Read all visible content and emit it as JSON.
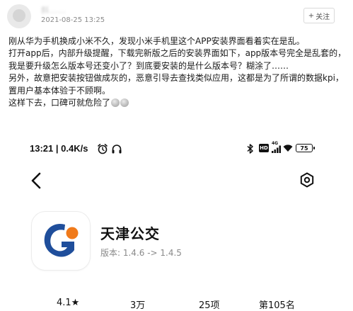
{
  "post": {
    "username": "斜……",
    "timestamp": "2021-08-25 13:25",
    "follow_label": "关注",
    "paragraphs": [
      "刚从华为手机换成小米不久，发现小米手机里这个APP安装界面看着实在是乱。",
      "打开app后，内部升级提醒，下载完新版之后的安装界面如下，app版本号完全是乱套的，我是要升级怎么版本号还变小了？到底要安装的是什么版本号？糊涂了……",
      "另外，故意把安装按钮做成灰的，恶意引导去查找类似应用，这都是为了所谓的数据kpi，置用户基本体验于不顾啊。"
    ],
    "last_line": "这样下去，口碑可就危险了"
  },
  "phone": {
    "status": {
      "time": "13:21",
      "speed": "0.4K/s",
      "network": "4G",
      "battery": "75"
    },
    "app": {
      "name": "天津公交",
      "version": "版本: 1.4.6 -> 1.4.5"
    },
    "stats": [
      {
        "value": "4.1★"
      },
      {
        "value": "3万"
      },
      {
        "value": "25项"
      },
      {
        "value": "第105名"
      }
    ]
  },
  "colors": {
    "logo_blue": "#1f4e9b",
    "logo_orange": "#f07a1a"
  }
}
